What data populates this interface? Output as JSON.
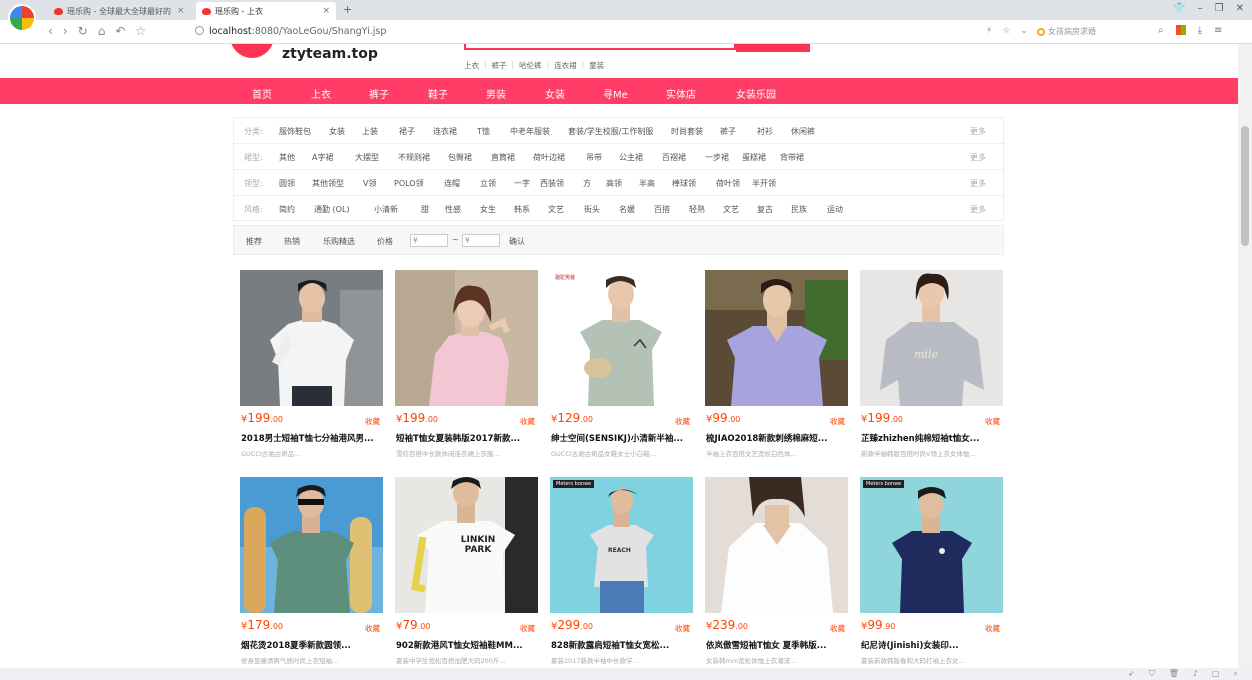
{
  "browser": {
    "tabs": [
      {
        "title": "瑶乐购 - 全球最大全球最好的"
      },
      {
        "title": "瑶乐购 - 上衣"
      }
    ],
    "new_tab": "+",
    "url_host": "localhost",
    "url_path": ":8080/YaoLeGou/ShangYi.jsp",
    "search_placeholder": "女孩病房求婚"
  },
  "site": {
    "logo_text": "ztyteam.top",
    "hot_words": [
      "上衣",
      "裤子",
      "哈伦裤",
      "连衣裙",
      "童装"
    ],
    "nav": [
      "首页",
      "上衣",
      "裤子",
      "鞋子",
      "男装",
      "女装",
      "寻Me",
      "实体店",
      "女装乐园"
    ]
  },
  "filters": [
    {
      "label": "分类:",
      "options": [
        "服饰鞋包",
        "女装",
        "上装",
        "裙子",
        "连衣裙",
        "T恤",
        "中老年服装",
        "套装/学生校服/工作制服",
        "时尚套装",
        "裤子",
        "衬衫",
        "休闲裤"
      ],
      "more": "更多"
    },
    {
      "label": "裙型:",
      "options": [
        "其他",
        "A字裙",
        "大摆型",
        "不规则裙",
        "包臀裙",
        "直筒裙",
        "荷叶边裙",
        "吊带",
        "公主裙",
        "百褶裙",
        "一步裙",
        "蛋糕裙",
        "背带裙"
      ],
      "more": "更多"
    },
    {
      "label": "领型:",
      "options": [
        "圆领",
        "其他领型",
        "V领",
        "POLO领",
        "连帽",
        "立领",
        "一字",
        "西装领",
        "方",
        "高领",
        "半高",
        "棒球领",
        "荷叶领",
        "半开领"
      ],
      "more": "更多"
    },
    {
      "label": "风格:",
      "options": [
        "简约",
        "通勤 (OL)",
        "小清新",
        "甜",
        "性感",
        "女生",
        "韩系",
        "文艺",
        "街头",
        "名媛",
        "百搭",
        "轻熟",
        "文艺",
        "复古",
        "民族",
        "运动"
      ],
      "more": "更多"
    }
  ],
  "sort": {
    "items": [
      "推荐",
      "热销",
      "乐购精选",
      "价格"
    ],
    "price_from": "¥",
    "price_to": "¥",
    "separator": "~",
    "confirm": "确认"
  },
  "products": [
    {
      "sym": "¥",
      "price": "199",
      "dec": ".00",
      "fav": "收藏",
      "title": "2018男士短袖T恤七分袖港风男...",
      "desc": "GUCCI古驰古奇品..."
    },
    {
      "sym": "¥",
      "price": "199",
      "dec": ".00",
      "fav": "收藏",
      "title": "短袖T恤女夏装韩版2017新款...",
      "desc": "雪纺百搭中长款休闲连衣裙上衣服..."
    },
    {
      "sym": "¥",
      "price": "129",
      "dec": ".00",
      "fav": "收藏",
      "title": "绅士空间(SENSIKJ)小清新半袖...",
      "desc": "GUCCI古驰古奇品女鞋女士小白鞋..."
    },
    {
      "sym": "¥",
      "price": "99",
      "dec": ".00",
      "fav": "收藏",
      "title": "梳JIAO2018新款刺绣棉麻短...",
      "desc": "半袖上衣百搭文艺宽松白色体..."
    },
    {
      "sym": "¥",
      "price": "199",
      "dec": ".00",
      "fav": "收藏",
      "title": "芷臻zhizhen纯棉短袖t恤女...",
      "desc": "新款半袖韩版百搭时尚V领上衣女体恤..."
    },
    {
      "sym": "¥",
      "price": "179",
      "dec": ".00",
      "fav": "收藏",
      "title": "烟花烫2018夏季新款圆领...",
      "desc": "修身显瘦清爽气质时尚上衣短袖..."
    },
    {
      "sym": "¥",
      "price": "79",
      "dec": ".00",
      "fav": "收藏",
      "title": "902新款港风T恤女短袖鞋MM...",
      "desc": "夏装中学生宽松百搭加肥大码200斤..."
    },
    {
      "sym": "¥",
      "price": "299",
      "dec": ".00",
      "fav": "收藏",
      "title": "828新款露肩短袖T恤女宽松...",
      "desc": "夏装2017新款半袖中长款学..."
    },
    {
      "sym": "¥",
      "price": "239",
      "dec": ".00",
      "fav": "收藏",
      "title": "依岚傲雪短袖T恤女 夏季韩版...",
      "desc": "女装韩mm宽松体恤上衣潮流..."
    },
    {
      "sym": "¥",
      "price": "99",
      "dec": ".90",
      "fav": "收藏",
      "title": "纪尼诗(Jinishi)女装印...",
      "desc": "夏装新款韩版春和大码打袖上衣女..."
    }
  ],
  "image_labels": {
    "camel": "骆驼男装",
    "brand": "Meters bonwe",
    "tshirt_text": "LINKIN PARK",
    "reach": "REACH"
  }
}
